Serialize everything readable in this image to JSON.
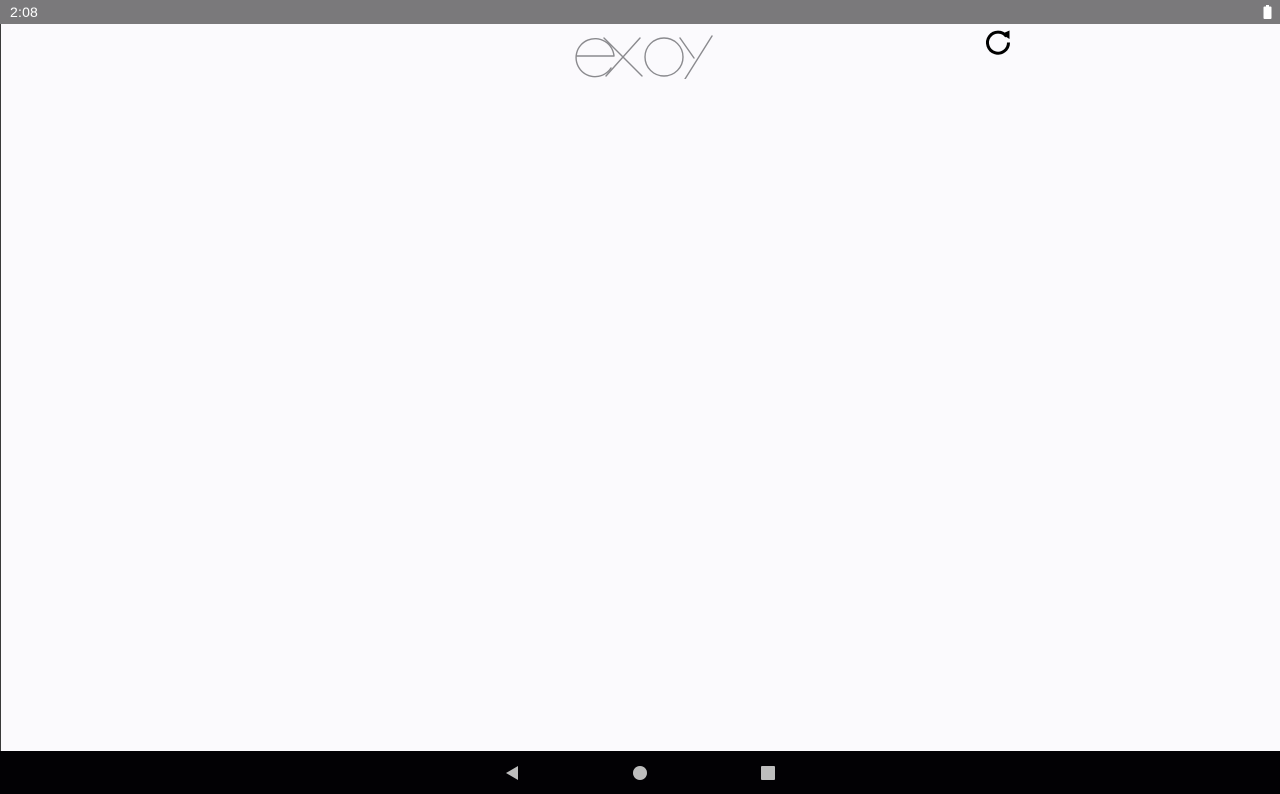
{
  "status_bar": {
    "time": "2:08",
    "battery_icon": "battery-full-icon"
  },
  "app": {
    "logo_text": "exoy",
    "refresh_icon": "refresh-icon"
  },
  "nav_bar": {
    "back_icon": "back-triangle-icon",
    "home_icon": "home-circle-icon",
    "recents_icon": "recents-square-icon"
  },
  "colors": {
    "status_bar_bg": "#7a797b",
    "app_bg": "#fbfafd",
    "nav_bar_bg": "#020104",
    "logo_stroke": "#8a8a8e",
    "nav_icon": "#bdbdbd"
  }
}
